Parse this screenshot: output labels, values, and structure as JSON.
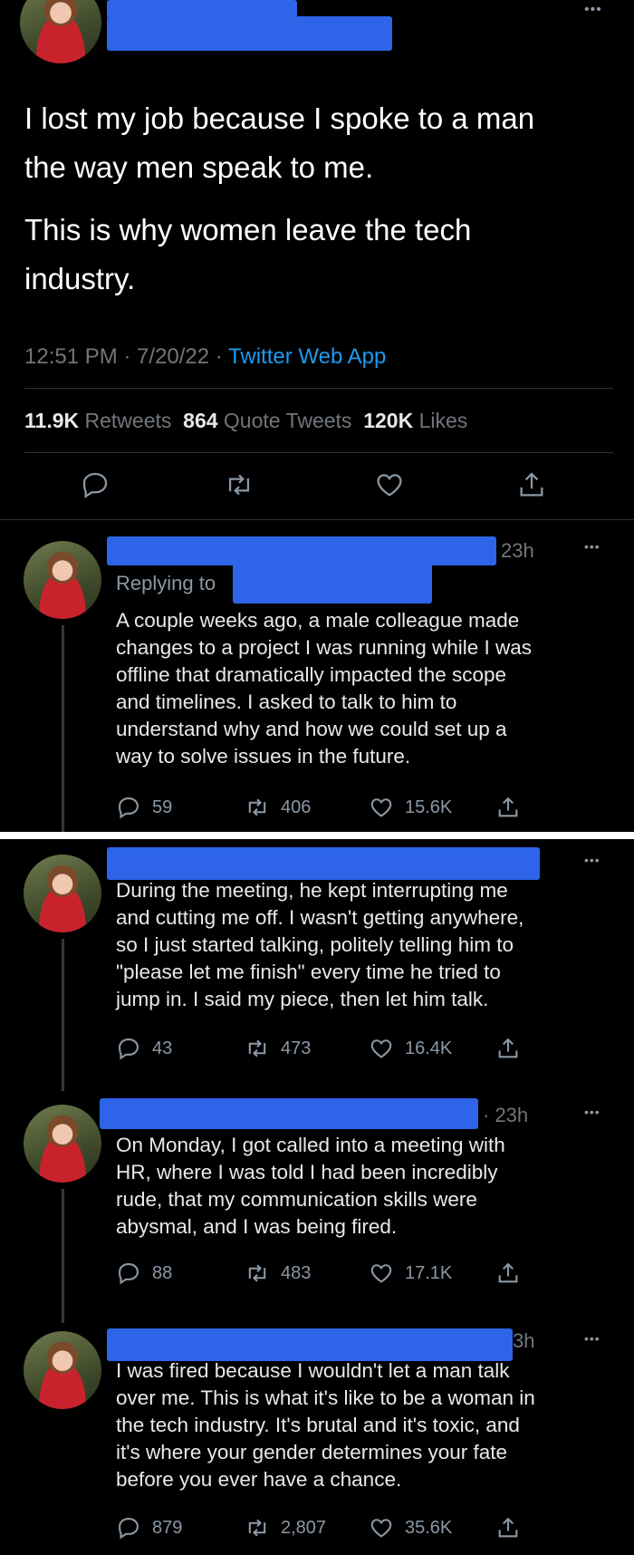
{
  "main_tweet": {
    "text_line1": "I lost my job because I spoke to a man",
    "text_line2": "the way men speak to me.",
    "text_line3": "This is why women leave the tech",
    "text_line4": "industry.",
    "time": "12:51 PM · 7/20/22 · ",
    "source": "Twitter Web App",
    "retweets_count": "11.9K",
    "retweets_label": "Retweets",
    "quotes_count": "864",
    "quotes_label": "Quote Tweets",
    "likes_count": "120K",
    "likes_label": "Likes"
  },
  "replies": [
    {
      "time": "23h",
      "replying_to": "Replying to",
      "lines": [
        "A couple weeks ago, a male colleague made",
        "changes to a project I was running while I was",
        "offline that dramatically impacted the scope",
        "and timelines. I asked to talk to him to",
        "understand why and how we could set up a",
        "way to solve issues in the future."
      ],
      "replies": "59",
      "retweets": "406",
      "likes": "15.6K"
    },
    {
      "time": "",
      "lines": [
        "During the meeting, he kept interrupting me",
        "and cutting me off. I wasn't getting anywhere,",
        "so I just started talking, politely telling him to",
        "\"please let me finish\" every time he tried to",
        "jump in. I said my piece, then let him talk."
      ],
      "replies": "43",
      "retweets": "473",
      "likes": "16.4K"
    },
    {
      "time": "· 23h",
      "lines": [
        "On Monday, I got called into a meeting with",
        "HR, where I was told I had been incredibly",
        "rude, that my communication skills were",
        "abysmal, and I was being fired."
      ],
      "replies": "88",
      "retweets": "483",
      "likes": "17.1K"
    },
    {
      "time": "3h",
      "lines": [
        "I was fired because I wouldn't let a man talk",
        "over me. This is what it's like to be a woman in",
        "the tech industry. It's brutal and it's toxic, and",
        "it's where your gender determines your fate",
        "before you ever have a chance."
      ],
      "replies": "879",
      "retweets": "2,807",
      "likes": "35.6K"
    }
  ],
  "icons": {
    "more": "•••"
  },
  "colors": {
    "redaction": "#2e64e8",
    "link": "#1d9bf0",
    "background": "#000000"
  }
}
